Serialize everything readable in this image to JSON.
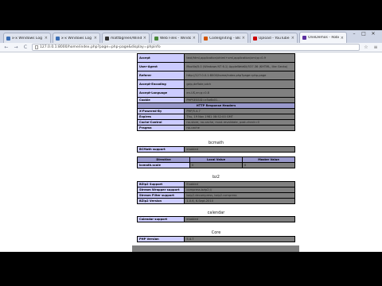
{
  "tabs": [
    {
      "title": "x-x Windows Log",
      "icon_color": "#3b6fb6",
      "active": false
    },
    {
      "title": "x-x Windows Log",
      "icon_color": "#3b6fb6",
      "active": false
    },
    {
      "title": "mattbgreen/Windows/...",
      "icon_color": "#333333",
      "active": false
    },
    {
      "title": "Web Files - Windows ...",
      "icon_color": "#4a8a3a",
      "active": false
    },
    {
      "title": "CodeIgniting - Blog ...",
      "icon_color": "#d35400",
      "active": false
    },
    {
      "title": "Upload - YouTube",
      "icon_color": "#cc0000",
      "active": false
    },
    {
      "title": "OneDemos - Roboworx",
      "icon_color": "#5b2fa0",
      "active": true
    }
  ],
  "tab_close_glyph": "×",
  "address": {
    "url": "127.0.0.1:8000/home/index.php?page=php-page&display=phpinfo"
  },
  "nav": {
    "back_glyph": "←",
    "forward_glyph": "→",
    "reload_glyph": "C",
    "star_glyph": "☆",
    "menu_glyph": "≡"
  },
  "window_buttons": {
    "minimize": "–",
    "maximize": "□",
    "close": "✕"
  },
  "header_rows": [
    {
      "name": "Accept",
      "value": "text/html,application/xhtml+xml,application/xml;q=0.9",
      "tall": true
    },
    {
      "name": "User-Agent",
      "value": "Mozilla/5.0 (Windows NT 6.1) AppleWebKit/537.36 (KHTML, like Gecko)",
      "tall": true
    },
    {
      "name": "Referer",
      "value": "http://127.0.0.1:8000/home/index.php?page=php-page",
      "tall": true
    },
    {
      "name": "Accept-Encoding",
      "value": "gzip,deflate,sdch",
      "tall": true
    },
    {
      "name": "Accept-Language",
      "value": "en-US,en;q=0.8",
      "tall": true
    },
    {
      "name": "Cookie",
      "value": "PHPSESSID=e5a6b01...",
      "tall": false
    }
  ],
  "response_header": "HTTP Response Headers",
  "response_rows": [
    {
      "name": "X-Powered-By",
      "value": "PHP/5.4.7"
    },
    {
      "name": "Expires",
      "value": "Thu, 19 Nov 1981 08:52:00 GMT"
    },
    {
      "name": "Cache-Control",
      "value": "no-store, no-cache, must-revalidate, post-check=0"
    },
    {
      "name": "Pragma",
      "value": "no-cache"
    }
  ],
  "sections": [
    {
      "title": "bcmath",
      "rows": [
        {
          "name": "BCMath support",
          "value": "enabled"
        }
      ],
      "subtable": {
        "header": [
          "Directive",
          "Local Value",
          "Master Value"
        ],
        "rows": [
          {
            "name": "bcmath.scale",
            "local": "0",
            "master": "0"
          }
        ]
      }
    },
    {
      "title": "bz2",
      "rows": [
        {
          "name": "BZip2 Support",
          "value": "Enabled"
        },
        {
          "name": "Stream Wrapper support",
          "value": "compress.bzip2://"
        },
        {
          "name": "Stream Filter support",
          "value": "bzip2.decompress, bzip2.compress"
        },
        {
          "name": "BZip2 Version",
          "value": "1.0.6, 6-Sept-2010"
        }
      ]
    },
    {
      "title": "calendar",
      "rows": [
        {
          "name": "Calendar support",
          "value": "enabled"
        }
      ]
    },
    {
      "title": "Core",
      "rows": [
        {
          "name": "PHP Version",
          "value": "5.4.7"
        }
      ]
    }
  ],
  "colors": {
    "entry_bg": "#ccccff",
    "value_bg": "#808080",
    "header_bg": "#9999cc"
  }
}
